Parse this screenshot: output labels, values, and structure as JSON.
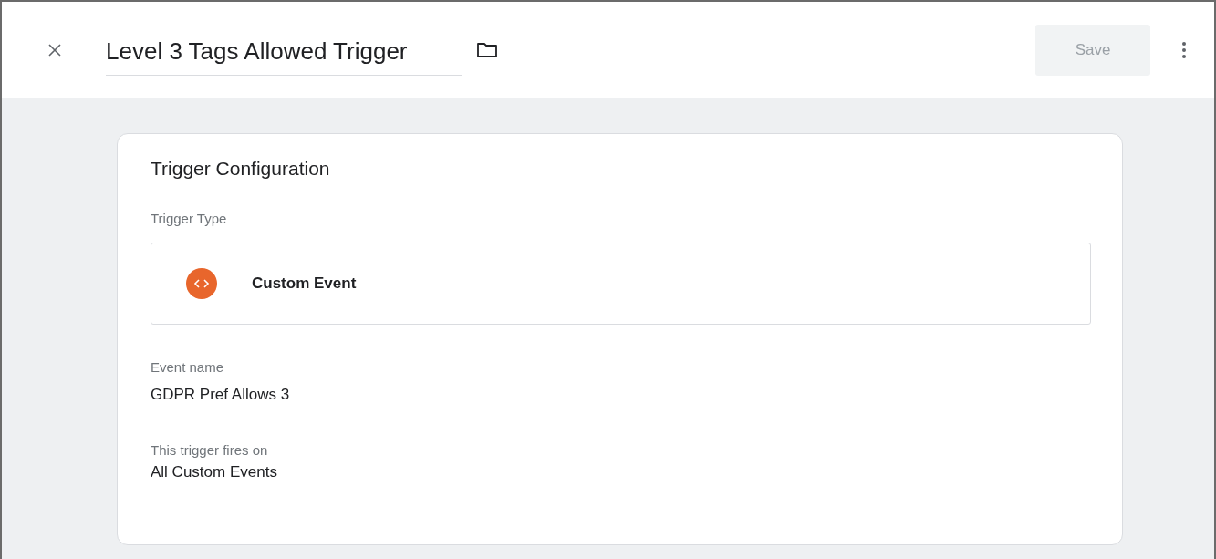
{
  "header": {
    "title": "Level 3 Tags Allowed Trigger",
    "save_button": {
      "label": "Save",
      "disabled": true
    }
  },
  "card": {
    "title": "Trigger Configuration",
    "trigger_type": {
      "label": "Trigger Type",
      "value": "Custom Event"
    },
    "fields": [
      {
        "label": "Event name",
        "value": "GDPR Pref Allows 3"
      },
      {
        "label": "This trigger fires on",
        "value": "All Custom Events"
      }
    ]
  }
}
